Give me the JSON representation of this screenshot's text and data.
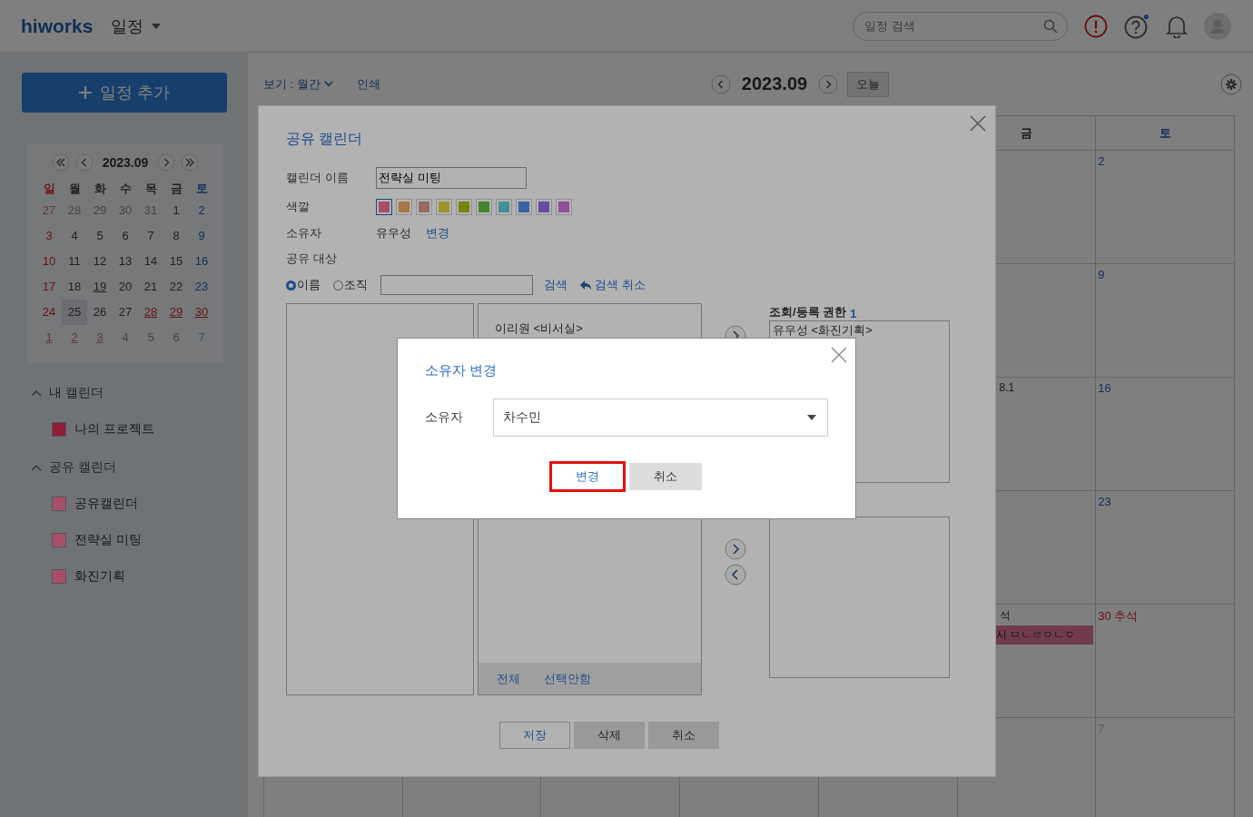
{
  "header": {
    "logo": "hiworks",
    "app_menu": "일정",
    "search": {
      "placeholder": "일정 검색"
    },
    "help_has_notification": true
  },
  "sidebar": {
    "add_button": "일정 추가",
    "mini_calendar": {
      "title": "2023.09",
      "weekdays": [
        "일",
        "월",
        "화",
        "수",
        "목",
        "금",
        "토"
      ],
      "weeks": [
        [
          {
            "label": "27",
            "outside": true,
            "holiday": true,
            "has_event": false,
            "selected": false
          },
          {
            "label": "28",
            "outside": true,
            "holiday": false,
            "has_event": false,
            "selected": false
          },
          {
            "label": "29",
            "outside": true,
            "holiday": false,
            "has_event": false,
            "selected": false
          },
          {
            "label": "30",
            "outside": true,
            "holiday": false,
            "has_event": false,
            "selected": false
          },
          {
            "label": "31",
            "outside": true,
            "holiday": false,
            "has_event": false,
            "selected": false
          },
          {
            "label": "1",
            "outside": false,
            "holiday": false,
            "has_event": false,
            "selected": false
          },
          {
            "label": "2",
            "outside": false,
            "holiday": false,
            "has_event": false,
            "selected": false
          }
        ],
        [
          {
            "label": "3",
            "outside": false,
            "holiday": true,
            "has_event": false,
            "selected": false
          },
          {
            "label": "4",
            "outside": false,
            "holiday": false,
            "has_event": false,
            "selected": false
          },
          {
            "label": "5",
            "outside": false,
            "holiday": false,
            "has_event": false,
            "selected": false
          },
          {
            "label": "6",
            "outside": false,
            "holiday": false,
            "has_event": false,
            "selected": false
          },
          {
            "label": "7",
            "outside": false,
            "holiday": false,
            "has_event": false,
            "selected": false
          },
          {
            "label": "8",
            "outside": false,
            "holiday": false,
            "has_event": false,
            "selected": false
          },
          {
            "label": "9",
            "outside": false,
            "holiday": false,
            "has_event": false,
            "selected": false
          }
        ],
        [
          {
            "label": "10",
            "outside": false,
            "holiday": true,
            "has_event": false,
            "selected": false
          },
          {
            "label": "11",
            "outside": false,
            "holiday": false,
            "has_event": false,
            "selected": false
          },
          {
            "label": "12",
            "outside": false,
            "holiday": false,
            "has_event": false,
            "selected": false
          },
          {
            "label": "13",
            "outside": false,
            "holiday": false,
            "has_event": false,
            "selected": false
          },
          {
            "label": "14",
            "outside": false,
            "holiday": false,
            "has_event": false,
            "selected": false
          },
          {
            "label": "15",
            "outside": false,
            "holiday": false,
            "has_event": false,
            "selected": false
          },
          {
            "label": "16",
            "outside": false,
            "holiday": false,
            "has_event": false,
            "selected": false
          }
        ],
        [
          {
            "label": "17",
            "outside": false,
            "holiday": true,
            "has_event": false,
            "selected": false
          },
          {
            "label": "18",
            "outside": false,
            "holiday": false,
            "has_event": false,
            "selected": false
          },
          {
            "label": "19",
            "outside": false,
            "holiday": false,
            "has_event": true,
            "selected": false
          },
          {
            "label": "20",
            "outside": false,
            "holiday": false,
            "has_event": false,
            "selected": false
          },
          {
            "label": "21",
            "outside": false,
            "holiday": false,
            "has_event": false,
            "selected": false
          },
          {
            "label": "22",
            "outside": false,
            "holiday": false,
            "has_event": false,
            "selected": false
          },
          {
            "label": "23",
            "outside": false,
            "holiday": false,
            "has_event": false,
            "selected": false
          }
        ],
        [
          {
            "label": "24",
            "outside": false,
            "holiday": true,
            "has_event": false,
            "selected": false
          },
          {
            "label": "25",
            "outside": false,
            "holiday": false,
            "has_event": false,
            "selected": true
          },
          {
            "label": "26",
            "outside": false,
            "holiday": false,
            "has_event": false,
            "selected": false
          },
          {
            "label": "27",
            "outside": false,
            "holiday": false,
            "has_event": false,
            "selected": false
          },
          {
            "label": "28",
            "outside": false,
            "holiday": true,
            "has_event": true,
            "selected": false
          },
          {
            "label": "29",
            "outside": false,
            "holiday": true,
            "has_event": true,
            "selected": false
          },
          {
            "label": "30",
            "outside": false,
            "holiday": true,
            "has_event": true,
            "selected": false
          }
        ],
        [
          {
            "label": "1",
            "outside": true,
            "holiday": true,
            "has_event": true,
            "selected": false
          },
          {
            "label": "2",
            "outside": true,
            "holiday": true,
            "has_event": true,
            "selected": false
          },
          {
            "label": "3",
            "outside": true,
            "holiday": true,
            "has_event": true,
            "selected": false
          },
          {
            "label": "4",
            "outside": true,
            "holiday": false,
            "has_event": false,
            "selected": false
          },
          {
            "label": "5",
            "outside": true,
            "holiday": false,
            "has_event": false,
            "selected": false
          },
          {
            "label": "6",
            "outside": true,
            "holiday": false,
            "has_event": false,
            "selected": false
          },
          {
            "label": "7",
            "outside": true,
            "holiday": false,
            "has_event": false,
            "selected": false
          }
        ]
      ]
    },
    "groups": [
      {
        "title": "내 캘린더",
        "expanded": true,
        "items": [
          {
            "label": "나의 프로젝트",
            "color": "#901c38",
            "checked": true
          }
        ]
      },
      {
        "title": "공유 캘린더",
        "expanded": true,
        "items": [
          {
            "label": "공유캘린더",
            "color": "#a8506a",
            "checked": true
          },
          {
            "label": "전략실 미팅",
            "color": "#a8506a",
            "checked": true
          },
          {
            "label": "화진기획",
            "color": "#a8506a",
            "checked": true
          }
        ]
      }
    ]
  },
  "toolbar": {
    "view": "보기 : 월간",
    "print": "인쇄",
    "period": "2023.09",
    "today": "오늘"
  },
  "calendar": {
    "columns": [
      {
        "label": "금",
        "kind": "weekday"
      },
      {
        "label": "토",
        "kind": "saturday"
      }
    ],
    "rows": [
      {
        "sat": {
          "label": "2",
          "holiday": false,
          "outside": false
        }
      },
      {
        "sat": {
          "label": "9",
          "holiday": false,
          "outside": false
        }
      },
      {
        "fri_note": "8.1",
        "sat": {
          "label": "16",
          "holiday": false,
          "outside": false
        }
      },
      {
        "sat": {
          "label": "23",
          "holiday": false,
          "outside": false
        }
      },
      {
        "fri_note": "석",
        "fri_event": "시 ㅁㄴㄹㅇㄴㅇ",
        "sat": {
          "label": "30 추석",
          "holiday": true,
          "outside": false
        }
      },
      {
        "sat": {
          "label": "7",
          "holiday": false,
          "outside": true
        }
      }
    ]
  },
  "share_dialog": {
    "title": "공유 캘린더",
    "name_label": "캘린더 이름",
    "name_value": "전략실 미팅",
    "color_label": "색깔",
    "swatches": [
      {
        "color": "#a84e65",
        "selected": true
      },
      {
        "color": "#a87643",
        "selected": false
      },
      {
        "color": "#976a61",
        "selected": false
      },
      {
        "color": "#a0922d",
        "selected": false
      },
      {
        "color": "#76860b",
        "selected": false
      },
      {
        "color": "#43862d",
        "selected": false
      },
      {
        "color": "#439197",
        "selected": false
      },
      {
        "color": "#3865a2",
        "selected": false
      },
      {
        "color": "#654e9d",
        "selected": false
      },
      {
        "color": "#924e97",
        "selected": false
      }
    ],
    "owner_label": "소유자",
    "owner": "유우성",
    "owner_change": "변경",
    "targets_label": "공유 대상",
    "search_modes": [
      {
        "label": "이름",
        "selected": true
      },
      {
        "label": "조직",
        "selected": false
      }
    ],
    "search_button": "검색",
    "search_cancel": "검색 취소",
    "members": [
      "이리원 <비서실>"
    ],
    "member_actions": [
      "전체",
      "선택안함"
    ],
    "permission": {
      "label": "조회/등록 권한",
      "count": "1",
      "members": [
        "유우성 <화진기획>"
      ]
    },
    "buttons": [
      {
        "label": "저장",
        "kind": "primary"
      },
      {
        "label": "삭제",
        "kind": "secondary"
      },
      {
        "label": "취소",
        "kind": "secondary"
      }
    ]
  },
  "owner_dialog": {
    "title": "소유자 변경",
    "label": "소유자",
    "value": "차수민",
    "buttons": [
      {
        "label": "변경",
        "kind": "primary",
        "highlighted": true
      },
      {
        "label": "취소",
        "kind": "secondary",
        "highlighted": false
      }
    ]
  }
}
